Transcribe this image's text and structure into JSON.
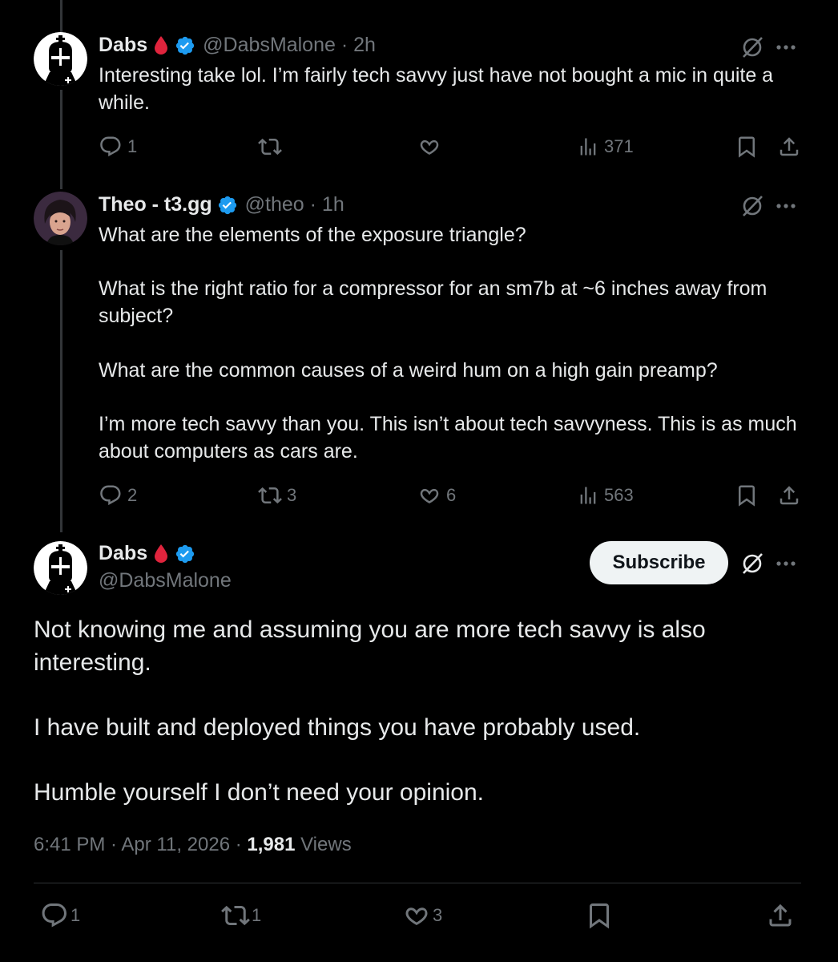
{
  "colors": {
    "background": "#000000",
    "text": "#e7e9ea",
    "muted": "#71767b",
    "verified_badge": "#1d9bf0",
    "blood_drop": "#e0243d",
    "divider": "#2f3336"
  },
  "reply1": {
    "display_name": "Dabs",
    "handle_time": "@DabsMalone · 2h",
    "text": "Interesting take lol. I’m fairly tech savvy just have not bought a mic in quite a while.",
    "replies": "1",
    "reposts": "",
    "likes": "",
    "views": "371"
  },
  "reply2": {
    "display_name": "Theo - t3.gg",
    "handle_time": "@theo · 1h",
    "paragraphs": [
      "What are the elements of the exposure triangle?",
      "What is the right ratio for a compressor for an sm7b at ~6 inches away from subject?",
      "What are the common causes of a weird hum on a high gain preamp?",
      "I’m more tech savvy than you. This isn’t about tech savvyness. This is as much about computers as cars are."
    ],
    "replies": "2",
    "reposts": "3",
    "likes": "6",
    "views": "563"
  },
  "main_post": {
    "display_name": "Dabs",
    "handle": "@DabsMalone",
    "subscribe_label": "Subscribe",
    "paragraphs": [
      "Not knowing me and assuming you are more tech savvy is also interesting.",
      "I have built and deployed things you have probably used.",
      "Humble yourself I don’t need your opinion."
    ],
    "timestamp": "6:41 PM · Apr 11, 2026 · ",
    "views_count": "1,981",
    "views_label": " Views",
    "replies": "1",
    "reposts": "1",
    "likes": "3"
  },
  "icons": [
    "more-icon",
    "grok-icon",
    "reply-icon",
    "repost-icon",
    "like-icon",
    "views-icon",
    "bookmark-icon",
    "share-icon",
    "verified-icon",
    "blood-drop-icon"
  ]
}
